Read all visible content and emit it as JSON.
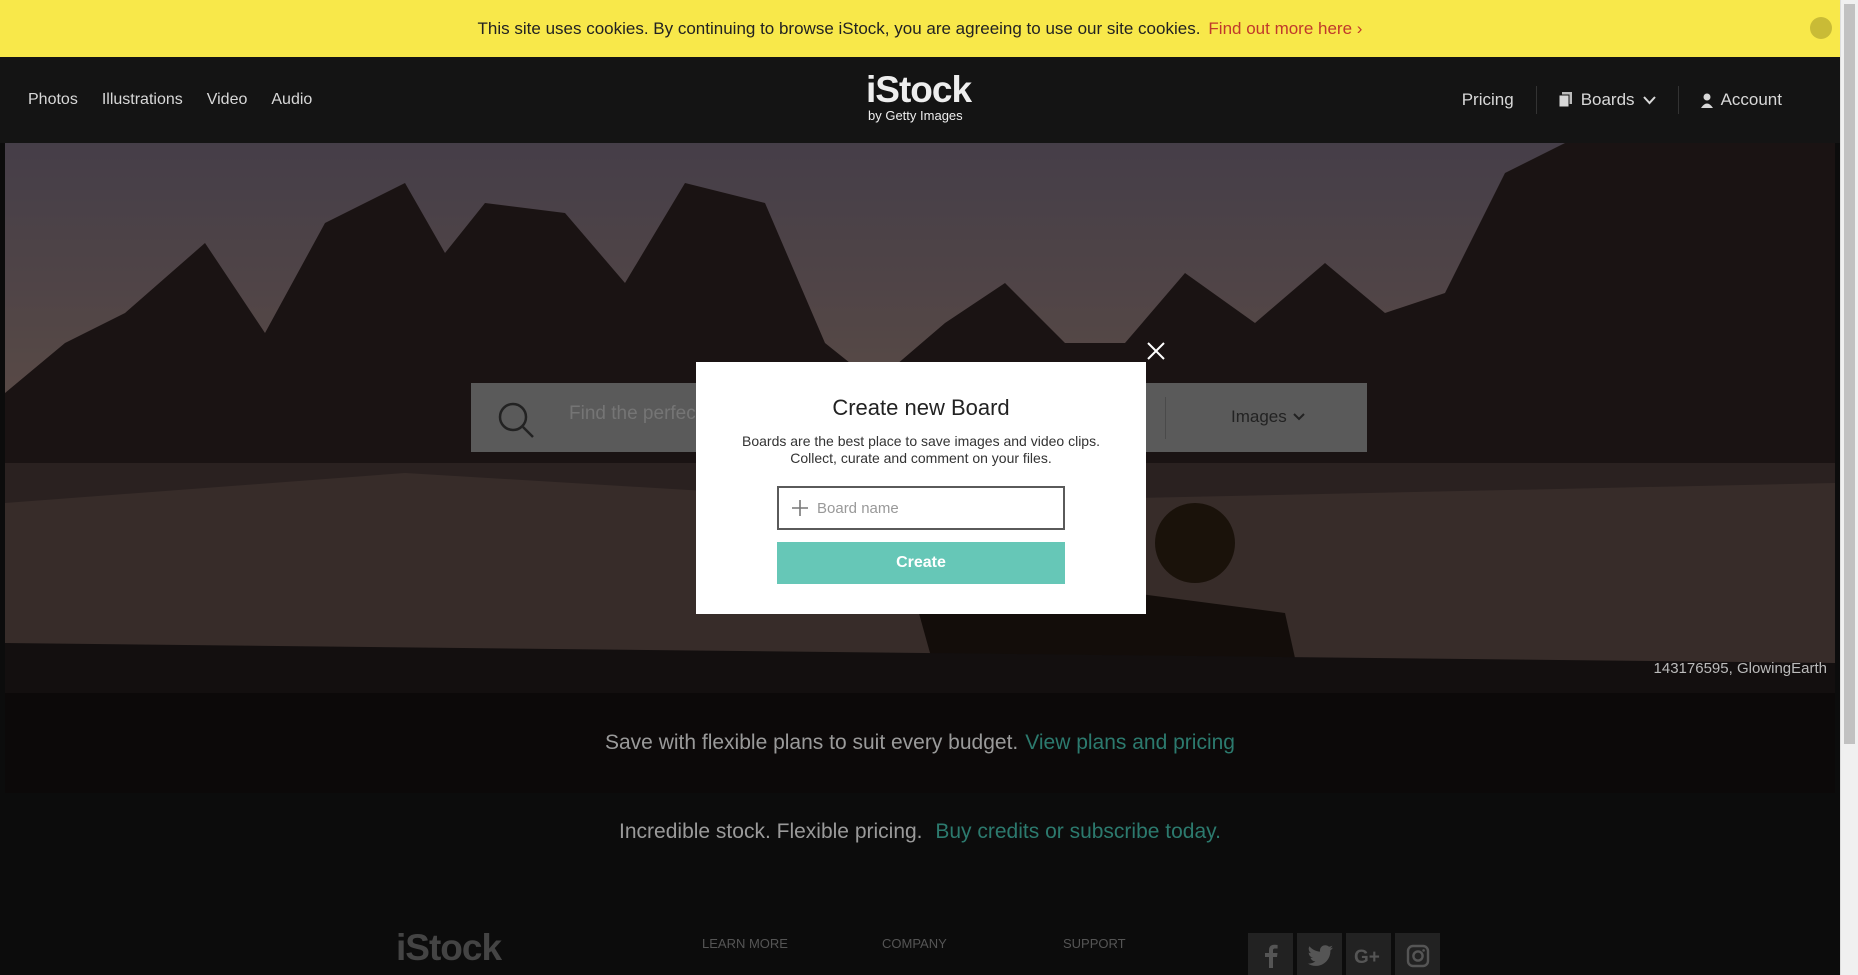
{
  "cookie": {
    "message": "This site uses cookies. By continuing to browse iStock, you are agreeing to use our site cookies.",
    "link": "Find out more here ›"
  },
  "nav": {
    "left": [
      "Photos",
      "Illustrations",
      "Video",
      "Audio"
    ],
    "logo_main": "iStock",
    "logo_sub": "by Getty Images",
    "pricing": "Pricing",
    "boards": "Boards",
    "account": "Account"
  },
  "search": {
    "placeholder": "Find the perfect",
    "type": "Images"
  },
  "hero": {
    "credit": "143176595, GlowingEarth",
    "promo_text": "Save with flexible plans to suit every budget.",
    "promo_link": "View plans and pricing"
  },
  "tagline": {
    "text": "Incredible stock. Flexible pricing.",
    "link": "Buy credits or subscribe today."
  },
  "footer": {
    "logo": "iStock",
    "columns": [
      "LEARN MORE",
      "COMPANY",
      "SUPPORT"
    ],
    "socials": [
      "facebook-icon",
      "twitter-icon",
      "google-plus-icon",
      "instagram-icon"
    ]
  },
  "modal": {
    "title": "Create new Board",
    "description": "Boards are the best place to save images and video clips. Collect, curate and comment on your files.",
    "input_placeholder": "Board name",
    "button": "Create"
  },
  "colors": {
    "cookie_bar": "#f8e84a",
    "accent": "#66c7b7",
    "link_teal": "#2c7a6e",
    "cookie_link": "#c0392b"
  }
}
